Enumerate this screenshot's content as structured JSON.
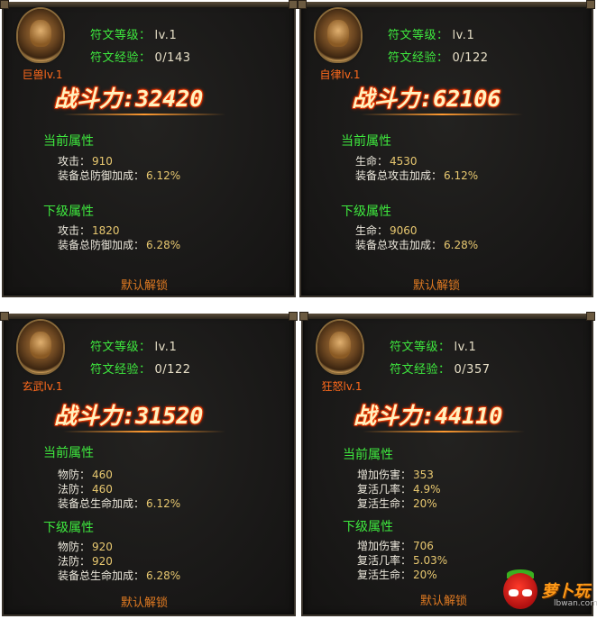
{
  "labels": {
    "level": "符文等级：",
    "exp": "符文经验：",
    "power": "战斗力:",
    "current": "当前属性",
    "next": "下级属性",
    "unlock": "默认解锁"
  },
  "panels": [
    {
      "rune_name": "巨兽lv.1",
      "level": "lv.1",
      "exp": "0/143",
      "power": "32420",
      "current": [
        {
          "label": "攻击：",
          "value": "910"
        },
        {
          "label": "装备总防御加成：",
          "value": "6.12%"
        }
      ],
      "next": [
        {
          "label": "攻击：",
          "value": "1820"
        },
        {
          "label": "装备总防御加成：",
          "value": "6.28%"
        }
      ]
    },
    {
      "rune_name": "自律lv.1",
      "level": "lv.1",
      "exp": "0/122",
      "power": "62106",
      "current": [
        {
          "label": "生命：",
          "value": "4530"
        },
        {
          "label": "装备总攻击加成：",
          "value": "6.12%"
        }
      ],
      "next": [
        {
          "label": "生命：",
          "value": "9060"
        },
        {
          "label": "装备总攻击加成：",
          "value": "6.28%"
        }
      ]
    },
    {
      "rune_name": "玄武lv.1",
      "level": "lv.1",
      "exp": "0/122",
      "power": "31520",
      "current": [
        {
          "label": "物防：",
          "value": "460"
        },
        {
          "label": "法防：",
          "value": "460"
        },
        {
          "label": "装备总生命加成：",
          "value": "6.12%"
        }
      ],
      "next": [
        {
          "label": "物防：",
          "value": "920"
        },
        {
          "label": "法防：",
          "value": "920"
        },
        {
          "label": "装备总生命加成：",
          "value": "6.28%"
        }
      ]
    },
    {
      "rune_name": "狂怒lv.1",
      "level": "lv.1",
      "exp": "0/357",
      "power": "44110",
      "current": [
        {
          "label": "增加伤害：",
          "value": "353"
        },
        {
          "label": "复活几率：",
          "value": "4.9%"
        },
        {
          "label": "复活生命：",
          "value": "20%"
        }
      ],
      "next": [
        {
          "label": "增加伤害：",
          "value": "706"
        },
        {
          "label": "复活几率：",
          "value": "5.03%"
        },
        {
          "label": "复活生命：",
          "value": "20%"
        }
      ]
    }
  ],
  "watermark": {
    "text": "萝卜玩",
    "url": "lbwan.com"
  }
}
